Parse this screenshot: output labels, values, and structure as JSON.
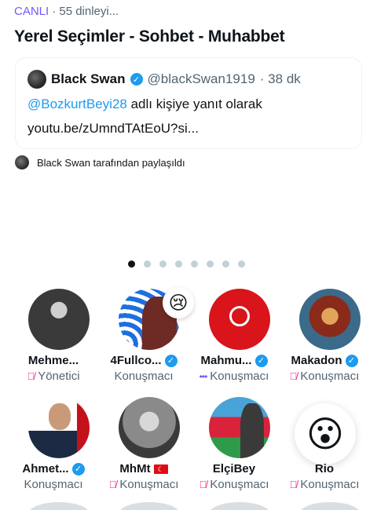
{
  "header": {
    "live_label": "CANLI",
    "listeners": "· 55 dinleyi..."
  },
  "space": {
    "title": "Yerel Seçimler - Sohbet - Muhabbet"
  },
  "tweet": {
    "author": "Black Swan",
    "handle": "@blackSwan1919",
    "time": "· 38 dk",
    "mention": "@BozkurtBeyi28",
    "reply_suffix": " adlı kişiye yanıt olarak",
    "link": "youtu.be/zUmndTAtEoU?si..."
  },
  "shared_by": "Black Swan tarafından paylaşıldı",
  "pagination": {
    "count": 8,
    "active_index": 0
  },
  "participants": [
    {
      "name": "Mehme...",
      "role": "Yönetici",
      "verified": false,
      "status": "muted"
    },
    {
      "name": "4Fullco...",
      "role": "Konuşmacı",
      "verified": true,
      "status": "none",
      "reaction": "😢"
    },
    {
      "name": "Mahmu...",
      "role": "Konuşmacı",
      "verified": true,
      "status": "speaking"
    },
    {
      "name": "Makadon",
      "role": "Konuşmacı",
      "verified": true,
      "status": "muted"
    },
    {
      "name": "Ahmet...",
      "role": "Konuşmacı",
      "verified": true,
      "status": "none"
    },
    {
      "name": "MhMt",
      "role": "Konuşmacı",
      "verified": false,
      "status": "muted",
      "flag": "TR"
    },
    {
      "name": "ElçiBey",
      "role": "Konuşmacı",
      "verified": false,
      "status": "muted"
    },
    {
      "name": "Rio",
      "role": "Konuşmacı",
      "verified": false,
      "status": "muted",
      "reaction": "😮"
    }
  ],
  "colors": {
    "accent": "#7856ff",
    "link": "#1d9bf0",
    "muted": "#f91880"
  },
  "icons": {
    "verified": "verified-check-icon",
    "mic_off": "mic-off-icon",
    "speaking": "speaking-dots-icon"
  }
}
